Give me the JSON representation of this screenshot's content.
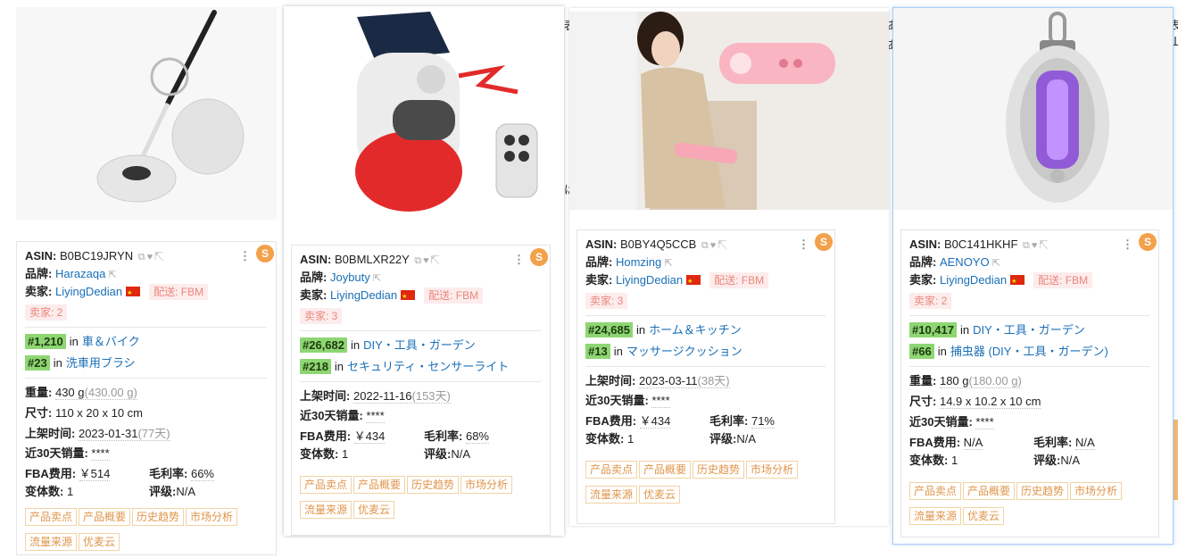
{
  "background_text": [
    "表",
    "Ш",
    "は",
    "あ",
    "あ",
    "Ш"
  ],
  "cards": [
    {
      "asin_label": "ASIN:",
      "asin": "B0BC19JRYN",
      "brand_label": "品牌:",
      "brand": "Harazaqa",
      "seller_label": "卖家:",
      "seller": "LiyingDedian",
      "ship": "配送: FBM",
      "seller_count": "卖家: 2",
      "ranks": [
        {
          "rank": "#1,210",
          "in": "in",
          "category": "車＆バイク"
        },
        {
          "rank": "#23",
          "in": "in",
          "category": "洗車用ブラシ"
        }
      ],
      "weight_label": "重量:",
      "weight": "430 g",
      "weight_alt": "(430.00 g)",
      "size_label": "尺寸:",
      "size": "110 x 20 x 10 cm",
      "listed_label": "上架时间:",
      "listed": "2023-01-31",
      "listed_days": "(77天)",
      "sales_label": "近30天销量:",
      "sales": "****",
      "fba_label": "FBA费用:",
      "fba": "￥514",
      "margin_label": "毛利率:",
      "margin": "66%",
      "variants_label": "变体数:",
      "variants": "1",
      "rating_label": "评级:",
      "rating": "N/A",
      "buttons": [
        "产品卖点",
        "产品概要",
        "历史趋势",
        "市场分析",
        "流量来源",
        "优麦云"
      ]
    },
    {
      "asin_label": "ASIN:",
      "asin": "B0BMLXR22Y",
      "brand_label": "品牌:",
      "brand": "Joybuty",
      "seller_label": "卖家:",
      "seller": "LiyingDedian",
      "ship": "配送: FBM",
      "seller_count": "卖家: 3",
      "ranks": [
        {
          "rank": "#26,682",
          "in": "in",
          "category": "DIY・工具・ガーデン"
        },
        {
          "rank": "#218",
          "in": "in",
          "category": "セキュリティ・センサーライト"
        }
      ],
      "listed_label": "上架时间:",
      "listed": "2022-11-16",
      "listed_days": "(153天)",
      "sales_label": "近30天销量:",
      "sales": "****",
      "fba_label": "FBA费用:",
      "fba": "￥434",
      "margin_label": "毛利率:",
      "margin": "68%",
      "variants_label": "变体数:",
      "variants": "1",
      "rating_label": "评级:",
      "rating": "N/A",
      "buttons": [
        "产品卖点",
        "产品概要",
        "历史趋势",
        "市场分析",
        "流量来源",
        "优麦云"
      ]
    },
    {
      "asin_label": "ASIN:",
      "asin": "B0BY4Q5CCB",
      "brand_label": "品牌:",
      "brand": "Homzing",
      "seller_label": "卖家:",
      "seller": "LiyingDedian",
      "ship": "配送: FBM",
      "seller_count": "卖家: 3",
      "ranks": [
        {
          "rank": "#24,685",
          "in": "in",
          "category": "ホーム＆キッチン"
        },
        {
          "rank": "#13",
          "in": "in",
          "category": "マッサージクッション"
        }
      ],
      "listed_label": "上架时间:",
      "listed": "2023-03-11",
      "listed_days": "(38天)",
      "sales_label": "近30天销量:",
      "sales": "****",
      "fba_label": "FBA费用:",
      "fba": "￥434",
      "margin_label": "毛利率:",
      "margin": "71%",
      "variants_label": "变体数:",
      "variants": "1",
      "rating_label": "评级:",
      "rating": "N/A",
      "buttons": [
        "产品卖点",
        "产品概要",
        "历史趋势",
        "市场分析",
        "流量来源",
        "优麦云"
      ]
    },
    {
      "asin_label": "ASIN:",
      "asin": "B0C141HKHF",
      "brand_label": "品牌:",
      "brand": "AENOYO",
      "seller_label": "卖家:",
      "seller": "LiyingDedian",
      "ship": "配送: FBM",
      "seller_count": "卖家: 2",
      "ranks": [
        {
          "rank": "#10,417",
          "in": "in",
          "category": "DIY・工具・ガーデン"
        },
        {
          "rank": "#66",
          "in": "in",
          "category": "捕虫器 (DIY・工具・ガーデン)"
        }
      ],
      "weight_label": "重量:",
      "weight": "180 g",
      "weight_alt": "(180.00 g)",
      "size_label": "尺寸:",
      "size": "14.9 x 10.2 x 10 cm",
      "sales_label": "近30天销量:",
      "sales": "****",
      "fba_label": "FBA费用:",
      "fba": "N/A",
      "margin_label": "毛利率:",
      "margin": "N/A",
      "variants_label": "变体数:",
      "variants": "1",
      "rating_label": "评级:",
      "rating": "N/A",
      "buttons": [
        "产品卖点",
        "产品概要",
        "历史趋势",
        "市场分析",
        "流量来源",
        "优麦云"
      ]
    }
  ],
  "logo_letter": "S",
  "kebab": "⋮",
  "colors": {
    "rank_green": "#8ed673",
    "link": "#1a6fb8",
    "button_orange": "#e0954b",
    "logo": "#f3a14a"
  }
}
